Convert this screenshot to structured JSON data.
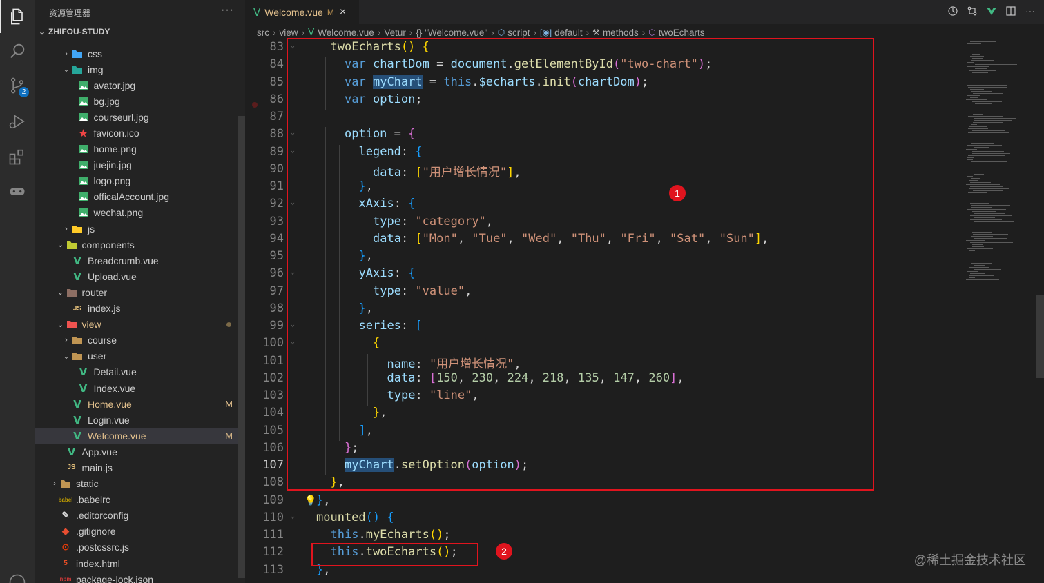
{
  "sidebar": {
    "title": "资源管理器",
    "more": "···",
    "root": "ZHIFOU-STUDY",
    "items": [
      {
        "label": "css",
        "type": "folder-css",
        "depth": 2,
        "chev": "›",
        "status": ""
      },
      {
        "label": "img",
        "type": "folder-img",
        "depth": 2,
        "chev": "⌄",
        "status": ""
      },
      {
        "label": "avator.jpg",
        "type": "image",
        "depth": 3,
        "chev": "",
        "status": ""
      },
      {
        "label": "bg.jpg",
        "type": "image",
        "depth": 3,
        "chev": "",
        "status": ""
      },
      {
        "label": "courseurl.jpg",
        "type": "image",
        "depth": 3,
        "chev": "",
        "status": ""
      },
      {
        "label": "favicon.ico",
        "type": "favicon",
        "depth": 3,
        "chev": "",
        "status": ""
      },
      {
        "label": "home.png",
        "type": "image",
        "depth": 3,
        "chev": "",
        "status": ""
      },
      {
        "label": "juejin.jpg",
        "type": "image",
        "depth": 3,
        "chev": "",
        "status": ""
      },
      {
        "label": "logo.png",
        "type": "image",
        "depth": 3,
        "chev": "",
        "status": ""
      },
      {
        "label": "officalAccount.jpg",
        "type": "image",
        "depth": 3,
        "chev": "",
        "status": ""
      },
      {
        "label": "wechat.png",
        "type": "image",
        "depth": 3,
        "chev": "",
        "status": ""
      },
      {
        "label": "js",
        "type": "folder-js",
        "depth": 2,
        "chev": "›",
        "status": ""
      },
      {
        "label": "components",
        "type": "folder-comp",
        "depth": 1,
        "chev": "⌄",
        "status": ""
      },
      {
        "label": "Breadcrumb.vue",
        "type": "vue",
        "depth": 2,
        "chev": "",
        "status": ""
      },
      {
        "label": "Upload.vue",
        "type": "vue",
        "depth": 2,
        "chev": "",
        "status": ""
      },
      {
        "label": "router",
        "type": "folder-router",
        "depth": 1,
        "chev": "⌄",
        "status": ""
      },
      {
        "label": "index.js",
        "type": "js",
        "depth": 2,
        "chev": "",
        "status": ""
      },
      {
        "label": "view",
        "type": "folder-view",
        "depth": 1,
        "chev": "⌄",
        "status": "dot",
        "mod": true
      },
      {
        "label": "course",
        "type": "folder",
        "depth": 2,
        "chev": "›",
        "status": ""
      },
      {
        "label": "user",
        "type": "folder-open",
        "depth": 2,
        "chev": "⌄",
        "status": ""
      },
      {
        "label": "Detail.vue",
        "type": "vue",
        "depth": 3,
        "chev": "",
        "status": ""
      },
      {
        "label": "Index.vue",
        "type": "vue",
        "depth": 3,
        "chev": "",
        "status": ""
      },
      {
        "label": "Home.vue",
        "type": "vue",
        "depth": 2,
        "chev": "",
        "status": "M",
        "mod": true
      },
      {
        "label": "Login.vue",
        "type": "vue",
        "depth": 2,
        "chev": "",
        "status": ""
      },
      {
        "label": "Welcome.vue",
        "type": "vue",
        "depth": 2,
        "chev": "",
        "status": "M",
        "mod": true,
        "selected": true
      },
      {
        "label": "App.vue",
        "type": "vue",
        "depth": 1,
        "chev": "",
        "status": ""
      },
      {
        "label": "main.js",
        "type": "js",
        "depth": 1,
        "chev": "",
        "status": ""
      },
      {
        "label": "static",
        "type": "folder",
        "depth": 0,
        "chev": "›",
        "status": ""
      },
      {
        "label": ".babelrc",
        "type": "babel",
        "depth": 0,
        "chev": "",
        "status": ""
      },
      {
        "label": ".editorconfig",
        "type": "editorconfig",
        "depth": 0,
        "chev": "",
        "status": ""
      },
      {
        "label": ".gitignore",
        "type": "git",
        "depth": 0,
        "chev": "",
        "status": ""
      },
      {
        "label": ".postcssrc.js",
        "type": "postcss",
        "depth": 0,
        "chev": "",
        "status": ""
      },
      {
        "label": "index.html",
        "type": "html",
        "depth": 0,
        "chev": "",
        "status": ""
      },
      {
        "label": "package-lock.json",
        "type": "npm",
        "depth": 0,
        "chev": "",
        "status": ""
      }
    ]
  },
  "activity": {
    "icons": [
      "files-icon",
      "search-icon",
      "source-control-icon",
      "run-debug-icon",
      "extensions-icon",
      "gamepad-icon"
    ],
    "scm_badge": "2"
  },
  "tab": {
    "label": "Welcome.vue",
    "status": "M",
    "close": "×"
  },
  "tab_actions": [
    "history-icon",
    "compare-icon",
    "vue-preview-icon",
    "split-editor-icon",
    "more-icon"
  ],
  "breadcrumb": {
    "parts": [
      "src",
      "view",
      "Welcome.vue",
      "Vetur",
      "{} \"Welcome.vue\"",
      "script",
      "default",
      "methods",
      "twoEcharts"
    ]
  },
  "editor": {
    "current_line": 107,
    "lines": [
      {
        "n": 83,
        "fold": "⌄",
        "indent": 1,
        "tokens": [
          [
            "f",
            "twoEcharts"
          ],
          [
            "b1",
            "("
          ],
          [
            "b1",
            ")"
          ],
          [
            "p",
            " "
          ],
          [
            "b1",
            "{"
          ]
        ]
      },
      {
        "n": 84,
        "fold": "",
        "indent": 2,
        "tokens": [
          [
            "k",
            "var"
          ],
          [
            "p",
            " "
          ],
          [
            "v",
            "chartDom"
          ],
          [
            "p",
            " = "
          ],
          [
            "v",
            "document"
          ],
          [
            "p",
            "."
          ],
          [
            "f",
            "getElementById"
          ],
          [
            "b2",
            "("
          ],
          [
            "s",
            "\"two-chart\""
          ],
          [
            "b2",
            ")"
          ],
          [
            "p",
            ";"
          ]
        ]
      },
      {
        "n": 85,
        "fold": "",
        "indent": 2,
        "tokens": [
          [
            "k",
            "var"
          ],
          [
            "p",
            " "
          ],
          [
            "v sel",
            "myChart"
          ],
          [
            "p",
            " = "
          ],
          [
            "k",
            "this"
          ],
          [
            "p",
            "."
          ],
          [
            "v",
            "$echarts"
          ],
          [
            "p",
            "."
          ],
          [
            "f",
            "init"
          ],
          [
            "b2",
            "("
          ],
          [
            "v",
            "chartDom"
          ],
          [
            "b2",
            ")"
          ],
          [
            "p",
            ";"
          ]
        ]
      },
      {
        "n": 86,
        "fold": "",
        "indent": 2,
        "tokens": [
          [
            "k",
            "var"
          ],
          [
            "p",
            " "
          ],
          [
            "v",
            "option"
          ],
          [
            "p",
            ";"
          ]
        ]
      },
      {
        "n": 87,
        "fold": "",
        "indent": 0,
        "tokens": []
      },
      {
        "n": 88,
        "fold": "⌄",
        "indent": 2,
        "tokens": [
          [
            "v",
            "option"
          ],
          [
            "p",
            " = "
          ],
          [
            "b2",
            "{"
          ]
        ]
      },
      {
        "n": 89,
        "fold": "⌄",
        "indent": 3,
        "tokens": [
          [
            "v",
            "legend"
          ],
          [
            "p",
            ": "
          ],
          [
            "b3",
            "{"
          ]
        ]
      },
      {
        "n": 90,
        "fold": "",
        "indent": 4,
        "tokens": [
          [
            "v",
            "data"
          ],
          [
            "p",
            ": "
          ],
          [
            "b1",
            "["
          ],
          [
            "s",
            "\"用户增长情况\""
          ],
          [
            "b1",
            "]"
          ],
          [
            "p",
            ","
          ]
        ]
      },
      {
        "n": 91,
        "fold": "",
        "indent": 3,
        "tokens": [
          [
            "b3",
            "}"
          ],
          [
            "p",
            ","
          ]
        ]
      },
      {
        "n": 92,
        "fold": "⌄",
        "indent": 3,
        "tokens": [
          [
            "v",
            "xAxis"
          ],
          [
            "p",
            ": "
          ],
          [
            "b3",
            "{"
          ]
        ]
      },
      {
        "n": 93,
        "fold": "",
        "indent": 4,
        "tokens": [
          [
            "v",
            "type"
          ],
          [
            "p",
            ": "
          ],
          [
            "s",
            "\"category\""
          ],
          [
            "p",
            ","
          ]
        ]
      },
      {
        "n": 94,
        "fold": "",
        "indent": 4,
        "tokens": [
          [
            "v",
            "data"
          ],
          [
            "p",
            ": "
          ],
          [
            "b1",
            "["
          ],
          [
            "s",
            "\"Mon\""
          ],
          [
            "p",
            ", "
          ],
          [
            "s",
            "\"Tue\""
          ],
          [
            "p",
            ", "
          ],
          [
            "s",
            "\"Wed\""
          ],
          [
            "p",
            ", "
          ],
          [
            "s",
            "\"Thu\""
          ],
          [
            "p",
            ", "
          ],
          [
            "s",
            "\"Fri\""
          ],
          [
            "p",
            ", "
          ],
          [
            "s",
            "\"Sat\""
          ],
          [
            "p",
            ", "
          ],
          [
            "s",
            "\"Sun\""
          ],
          [
            "b1",
            "]"
          ],
          [
            "p",
            ","
          ]
        ]
      },
      {
        "n": 95,
        "fold": "",
        "indent": 3,
        "tokens": [
          [
            "b3",
            "}"
          ],
          [
            "p",
            ","
          ]
        ]
      },
      {
        "n": 96,
        "fold": "⌄",
        "indent": 3,
        "tokens": [
          [
            "v",
            "yAxis"
          ],
          [
            "p",
            ": "
          ],
          [
            "b3",
            "{"
          ]
        ]
      },
      {
        "n": 97,
        "fold": "",
        "indent": 4,
        "tokens": [
          [
            "v",
            "type"
          ],
          [
            "p",
            ": "
          ],
          [
            "s",
            "\"value\""
          ],
          [
            "p",
            ","
          ]
        ]
      },
      {
        "n": 98,
        "fold": "",
        "indent": 3,
        "tokens": [
          [
            "b3",
            "}"
          ],
          [
            "p",
            ","
          ]
        ]
      },
      {
        "n": 99,
        "fold": "⌄",
        "indent": 3,
        "tokens": [
          [
            "v",
            "series"
          ],
          [
            "p",
            ": "
          ],
          [
            "b3",
            "["
          ]
        ]
      },
      {
        "n": 100,
        "fold": "⌄",
        "indent": 4,
        "tokens": [
          [
            "b1",
            "{"
          ]
        ]
      },
      {
        "n": 101,
        "fold": "",
        "indent": 5,
        "tokens": [
          [
            "v",
            "name"
          ],
          [
            "p",
            ": "
          ],
          [
            "s",
            "\"用户增长情况\""
          ],
          [
            "p",
            ","
          ]
        ]
      },
      {
        "n": 102,
        "fold": "",
        "indent": 5,
        "tokens": [
          [
            "v",
            "data"
          ],
          [
            "p",
            ": "
          ],
          [
            "b2",
            "["
          ],
          [
            "n",
            "150"
          ],
          [
            "p",
            ", "
          ],
          [
            "n",
            "230"
          ],
          [
            "p",
            ", "
          ],
          [
            "n",
            "224"
          ],
          [
            "p",
            ", "
          ],
          [
            "n",
            "218"
          ],
          [
            "p",
            ", "
          ],
          [
            "n",
            "135"
          ],
          [
            "p",
            ", "
          ],
          [
            "n",
            "147"
          ],
          [
            "p",
            ", "
          ],
          [
            "n",
            "260"
          ],
          [
            "b2",
            "]"
          ],
          [
            "p",
            ","
          ]
        ]
      },
      {
        "n": 103,
        "fold": "",
        "indent": 5,
        "tokens": [
          [
            "v",
            "type"
          ],
          [
            "p",
            ": "
          ],
          [
            "s",
            "\"line\""
          ],
          [
            "p",
            ","
          ]
        ]
      },
      {
        "n": 104,
        "fold": "",
        "indent": 4,
        "tokens": [
          [
            "b1",
            "}"
          ],
          [
            "p",
            ","
          ]
        ]
      },
      {
        "n": 105,
        "fold": "",
        "indent": 3,
        "tokens": [
          [
            "b3",
            "]"
          ],
          [
            "p",
            ","
          ]
        ]
      },
      {
        "n": 106,
        "fold": "",
        "indent": 2,
        "tokens": [
          [
            "b2",
            "}"
          ],
          [
            "p",
            ";"
          ]
        ]
      },
      {
        "n": 107,
        "fold": "",
        "indent": 2,
        "tokens": [
          [
            "v sel",
            "myChart"
          ],
          [
            "p",
            "."
          ],
          [
            "f",
            "setOption"
          ],
          [
            "b2",
            "("
          ],
          [
            "v",
            "option"
          ],
          [
            "b2",
            ")"
          ],
          [
            "p",
            ";"
          ]
        ]
      },
      {
        "n": 108,
        "fold": "",
        "indent": 1,
        "tokens": [
          [
            "b1",
            "}"
          ],
          [
            "p",
            ","
          ]
        ]
      },
      {
        "n": 109,
        "fold": "",
        "indent": 0,
        "tokens": [
          [
            "b3",
            "}"
          ],
          [
            "p",
            ","
          ]
        ]
      },
      {
        "n": 110,
        "fold": "⌄",
        "indent": 0,
        "tokens": [
          [
            "f",
            "mounted"
          ],
          [
            "b3",
            "("
          ],
          [
            "b3",
            ")"
          ],
          [
            "p",
            " "
          ],
          [
            "b3",
            "{"
          ]
        ]
      },
      {
        "n": 111,
        "fold": "",
        "indent": 1,
        "tokens": [
          [
            "k",
            "this"
          ],
          [
            "p",
            "."
          ],
          [
            "f",
            "myEcharts"
          ],
          [
            "b1",
            "("
          ],
          [
            "b1",
            ")"
          ],
          [
            "p",
            ";"
          ]
        ]
      },
      {
        "n": 112,
        "fold": "",
        "indent": 1,
        "tokens": [
          [
            "k",
            "this"
          ],
          [
            "p",
            "."
          ],
          [
            "f",
            "twoEcharts"
          ],
          [
            "b1",
            "("
          ],
          [
            "b1",
            ")"
          ],
          [
            "p",
            ";"
          ]
        ]
      },
      {
        "n": 113,
        "fold": "",
        "indent": 0,
        "tokens": [
          [
            "b3",
            "}"
          ],
          [
            "p",
            ","
          ]
        ]
      }
    ]
  },
  "annotations": {
    "label1": "1",
    "label2": "2",
    "color": "#e0141e"
  },
  "watermark": "@稀土掘金技术社区"
}
